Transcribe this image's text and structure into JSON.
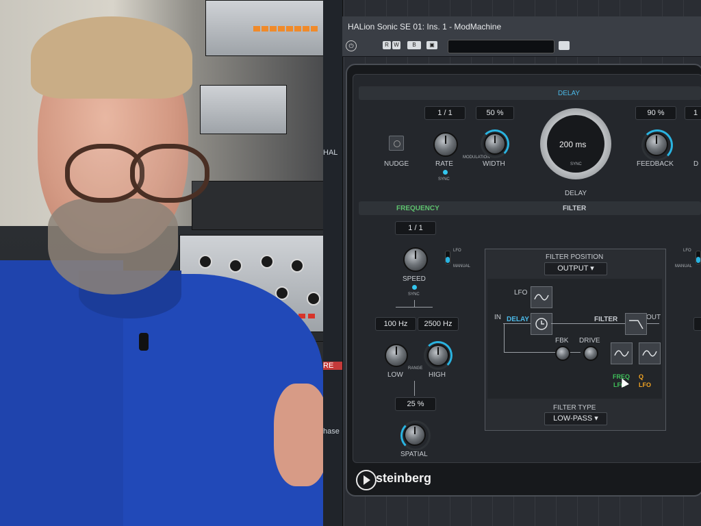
{
  "window": {
    "title": "HALion Sonic SE 01: Ins. 1 - ModMachine"
  },
  "toolbar": {
    "btn_r": "R",
    "btn_w": "W",
    "btn_compare": "B",
    "btn_save": "▣",
    "preset": "",
    "camera_icon": "camera-icon"
  },
  "side_strip": {
    "tab1": "HAL",
    "tab2": "RE",
    "tab3": "hase"
  },
  "delay": {
    "header": "DELAY",
    "rate_value": "1 / 1",
    "width_value": "50 %",
    "feedback_value": "90 %",
    "extra_value": "1",
    "nudge_label": "NUDGE",
    "rate_label": "RATE",
    "modulation_label": "MODULATION",
    "width_label": "WIDTH",
    "sync_label": "SYNC",
    "delay_time": "200 ms",
    "delay_sync": "SYNC",
    "delay_label": "DELAY",
    "feedback_label": "FEEDBACK",
    "dr_label": "D"
  },
  "filter": {
    "frequency_header": "FREQUENCY",
    "filter_header": "FILTER",
    "speed_value": "1 / 1",
    "speed_label": "SPEED",
    "sync_label": "SYNC",
    "lfo_label": "LFO",
    "manual_label": "MANUAL",
    "low_value": "100 Hz",
    "high_value": "2500 Hz",
    "low_label": "LOW",
    "range_label": "RANGE",
    "high_label": "HIGH",
    "spatial_value": "25 %",
    "spatial_label": "SPATIAL",
    "right_lfo_label": "LFO",
    "right_manual_label": "MANUAL"
  },
  "routing": {
    "position_title": "FILTER POSITION",
    "position_value": "OUTPUT",
    "lfo_label": "LFO",
    "in_label": "IN",
    "delay_label": "DELAY",
    "filter_label": "FILTER",
    "out_label": "OUT",
    "fbk_label": "FBK",
    "drive_label": "DRIVE",
    "freq_label": "FREQ",
    "freq_lfo_label": "LFO",
    "q_label": "Q",
    "q_lfo_label": "LFO",
    "type_title": "FILTER TYPE",
    "type_value": "LOW-PASS"
  },
  "brand": {
    "name": "steinberg"
  },
  "colors": {
    "accent_blue": "#2ab3e0",
    "freq_green": "#3fc05a",
    "q_orange": "#f0a323"
  }
}
